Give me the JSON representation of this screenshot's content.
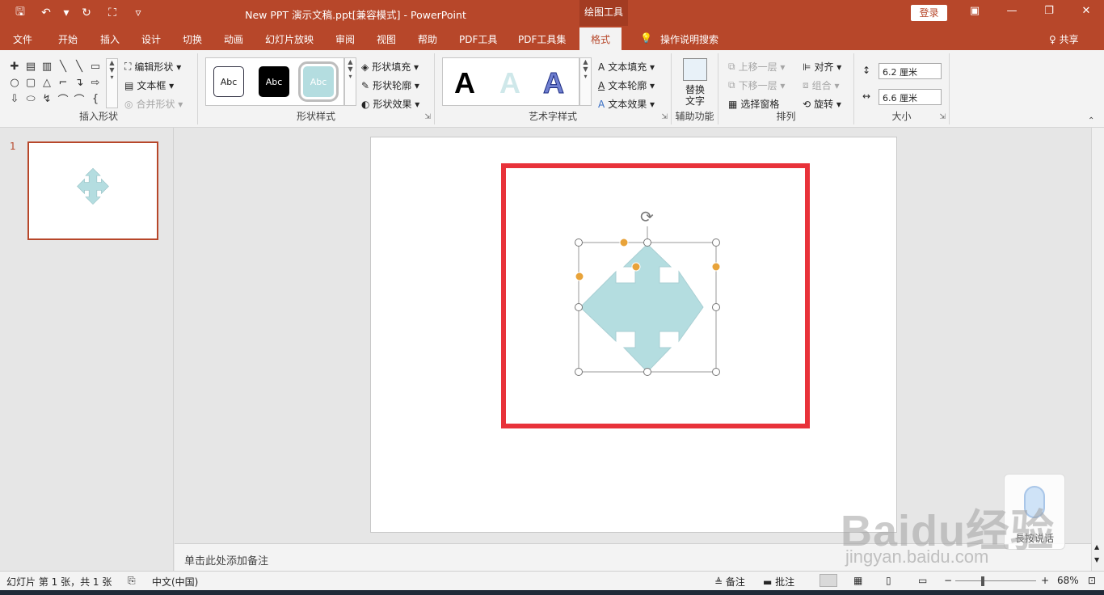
{
  "titlebar": {
    "title": "New PPT 演示文稿.ppt[兼容模式]  -  PowerPoint",
    "context_tools": "绘图工具",
    "login": "登录",
    "qat": {
      "save": "🖫",
      "undo": "↶",
      "undo_more": "▾",
      "redo": "↻",
      "present": "⛶",
      "customize": "▿"
    },
    "win": {
      "ribbon_opts": "▣",
      "minimize": "—",
      "restore": "❐",
      "close": "✕"
    }
  },
  "tabs": [
    "文件",
    "开始",
    "插入",
    "设计",
    "切换",
    "动画",
    "幻灯片放映",
    "审阅",
    "视图",
    "帮助",
    "PDF工具",
    "PDF工具集",
    "格式"
  ],
  "tell_me": {
    "icon": "💡",
    "label": "操作说明搜索"
  },
  "share": "♀ 共享",
  "ribbon": {
    "insert_shapes": {
      "label": "插入形状",
      "shapes": [
        "✚",
        "▤",
        "▥",
        "╲",
        "╲",
        "▭",
        "○",
        "▢",
        "△",
        "⌐",
        "↴",
        "⇨",
        "⇩",
        "⬭",
        "↯",
        "⌒",
        "⌒",
        "{"
      ],
      "edit_shape": "编辑形状 ▾",
      "text_box": "文本框 ▾",
      "merge_shapes": "合并形状 ▾"
    },
    "shape_styles": {
      "label": "形状样式",
      "samples": [
        "Abc",
        "Abc",
        "Abc"
      ],
      "fill": "形状填充 ▾",
      "outline": "形状轮廓 ▾",
      "effects": "形状效果 ▾"
    },
    "wordart": {
      "label": "艺术字样式",
      "samples": [
        "A",
        "A",
        "A"
      ],
      "text_fill": "文本填充 ▾",
      "text_outline": "文本轮廓 ▾",
      "text_effects": "文本效果 ▾"
    },
    "accessibility": {
      "label": "辅助功能",
      "alt_text_1": "替换",
      "alt_text_2": "文字"
    },
    "arrange": {
      "label": "排列",
      "bring_forward": "上移一层 ▾",
      "send_backward": "下移一层 ▾",
      "selection_pane": "选择窗格",
      "align": "对齐 ▾",
      "group": "组合 ▾",
      "rotate": "旋转 ▾"
    },
    "size": {
      "label": "大小",
      "height": "6.2 厘米",
      "width": "6.6 厘米"
    }
  },
  "slides": {
    "number": "1"
  },
  "notes_placeholder": "单击此处添加备注",
  "status": {
    "slide_info": "幻灯片 第 1 张，共 1 张",
    "language": "中文(中国)",
    "notes": "≜ 备注",
    "comments": "▬ 批注",
    "zoom": "68%",
    "minus": "−",
    "plus": "+"
  },
  "overlay": {
    "voice": "長按说话",
    "watermark": "Baidu经验",
    "watermark_url": "jingyan.baidu.com"
  },
  "colors": {
    "accent": "#b7472a",
    "shape_fill": "#b4dde0",
    "highlight": "#e8323a",
    "handle_orange": "#e8a33a"
  }
}
